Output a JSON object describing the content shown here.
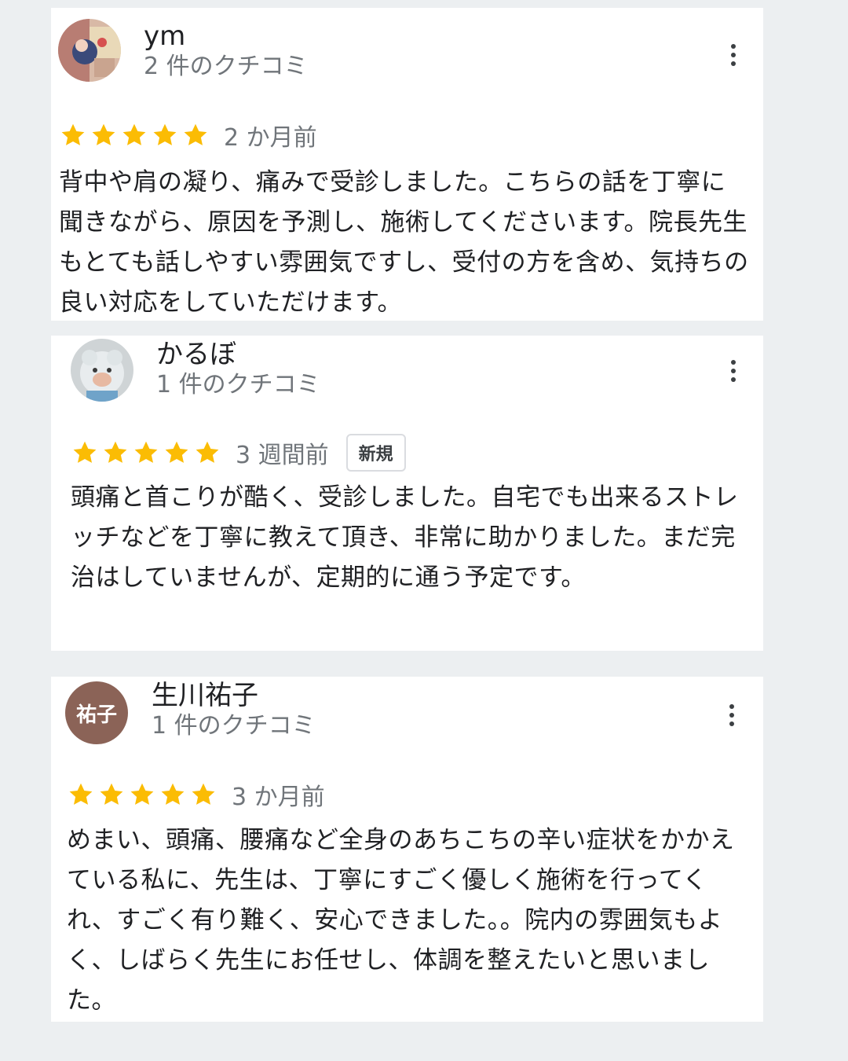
{
  "reviews": [
    {
      "author": "ym",
      "review_count": "2 件のクチコミ",
      "rating": 5,
      "date": "2 か月前",
      "badge": "",
      "avatar_type": "photo-icon",
      "text": "背中や肩の凝り、痛みで受診しました。こちらの話を丁寧に聞きながら、原因を予測し、施術してくださいます。院長先生もとても話しやすい雰囲気ですし、受付の方を含め、気持ちの良い対応をしていただけます。"
    },
    {
      "author": "かるぼ",
      "review_count": "1 件のクチコミ",
      "rating": 5,
      "date": "3 週間前",
      "badge": "新規",
      "avatar_type": "plush-toy-icon",
      "text": "頭痛と首こりが酷く、受診しました。自宅でも出来るストレッチなどを丁寧に教えて頂き、非常に助かりました。まだ完治はしていませんが、定期的に通う予定です。"
    },
    {
      "author": "生川祐子",
      "review_count": "1 件のクチコミ",
      "rating": 5,
      "date": "3 か月前",
      "badge": "",
      "avatar_initials": "祐子",
      "text": "めまい、頭痛、腰痛など全身のあちこちの辛い症状をかかえている私に、先生は、丁寧にすごく優しく施術を行ってくれ、すごく有り難く、安心できました。。院内の雰囲気もよく、しばらく先生にお任せし、体調を整えたいと思いました。"
    }
  ],
  "colors": {
    "star": "#fbbc04",
    "background": "#eceff1",
    "card": "#ffffff",
    "secondary_text": "#70757a",
    "initials_avatar": "#8b6357"
  },
  "icons": {
    "menu": "more-vert-icon",
    "star": "star-icon"
  }
}
